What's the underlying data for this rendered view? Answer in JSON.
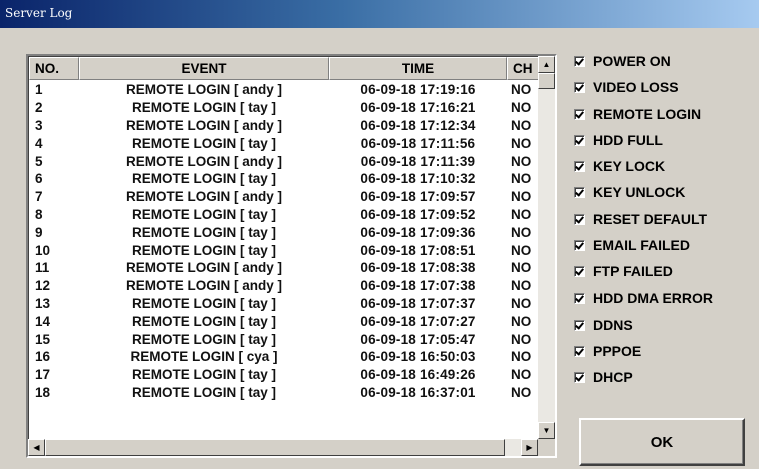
{
  "window": {
    "title": "Server Log"
  },
  "log_table": {
    "columns": [
      "NO.",
      "EVENT",
      "TIME",
      "CH"
    ],
    "rows": [
      {
        "no": "1",
        "event": "REMOTE LOGIN [ andy ]",
        "time": "06-09-18 17:19:16",
        "ch": "NO"
      },
      {
        "no": "2",
        "event": "REMOTE LOGIN [ tay ]",
        "time": "06-09-18 17:16:21",
        "ch": "NO"
      },
      {
        "no": "3",
        "event": "REMOTE LOGIN [ andy ]",
        "time": "06-09-18 17:12:34",
        "ch": "NO"
      },
      {
        "no": "4",
        "event": "REMOTE LOGIN [ tay ]",
        "time": "06-09-18 17:11:56",
        "ch": "NO"
      },
      {
        "no": "5",
        "event": "REMOTE LOGIN [ andy ]",
        "time": "06-09-18 17:11:39",
        "ch": "NO"
      },
      {
        "no": "6",
        "event": "REMOTE LOGIN [ tay ]",
        "time": "06-09-18 17:10:32",
        "ch": "NO"
      },
      {
        "no": "7",
        "event": "REMOTE LOGIN [ andy ]",
        "time": "06-09-18 17:09:57",
        "ch": "NO"
      },
      {
        "no": "8",
        "event": "REMOTE LOGIN [ tay ]",
        "time": "06-09-18 17:09:52",
        "ch": "NO"
      },
      {
        "no": "9",
        "event": "REMOTE LOGIN [ tay ]",
        "time": "06-09-18 17:09:36",
        "ch": "NO"
      },
      {
        "no": "10",
        "event": "REMOTE LOGIN [ tay ]",
        "time": "06-09-18 17:08:51",
        "ch": "NO"
      },
      {
        "no": "11",
        "event": "REMOTE LOGIN [ andy ]",
        "time": "06-09-18 17:08:38",
        "ch": "NO"
      },
      {
        "no": "12",
        "event": "REMOTE LOGIN [ andy ]",
        "time": "06-09-18 17:07:38",
        "ch": "NO"
      },
      {
        "no": "13",
        "event": "REMOTE LOGIN [ tay ]",
        "time": "06-09-18 17:07:37",
        "ch": "NO"
      },
      {
        "no": "14",
        "event": "REMOTE LOGIN [ tay ]",
        "time": "06-09-18 17:07:27",
        "ch": "NO"
      },
      {
        "no": "15",
        "event": "REMOTE LOGIN [ tay ]",
        "time": "06-09-18 17:05:47",
        "ch": "NO"
      },
      {
        "no": "16",
        "event": "REMOTE LOGIN [ cya ]",
        "time": "06-09-18 16:50:03",
        "ch": "NO"
      },
      {
        "no": "17",
        "event": "REMOTE LOGIN [ tay ]",
        "time": "06-09-18 16:49:26",
        "ch": "NO"
      },
      {
        "no": "18",
        "event": "REMOTE LOGIN [ tay ]",
        "time": "06-09-18 16:37:01",
        "ch": "NO"
      }
    ]
  },
  "filters": [
    {
      "label": "POWER ON",
      "checked": true
    },
    {
      "label": "VIDEO LOSS",
      "checked": true
    },
    {
      "label": "REMOTE LOGIN",
      "checked": true
    },
    {
      "label": "HDD FULL",
      "checked": true
    },
    {
      "label": "KEY LOCK",
      "checked": true
    },
    {
      "label": "KEY UNLOCK",
      "checked": true
    },
    {
      "label": "RESET DEFAULT",
      "checked": true
    },
    {
      "label": "EMAIL FAILED",
      "checked": true
    },
    {
      "label": "FTP FAILED",
      "checked": true
    },
    {
      "label": "HDD DMA ERROR",
      "checked": true
    },
    {
      "label": "DDNS",
      "checked": true
    },
    {
      "label": "PPPOE",
      "checked": true
    },
    {
      "label": "DHCP",
      "checked": true
    }
  ],
  "ok_button": {
    "label": "OK"
  },
  "icons": {
    "scroll_up": "▲",
    "scroll_down": "▼",
    "scroll_left": "◀",
    "scroll_right": "▶"
  }
}
